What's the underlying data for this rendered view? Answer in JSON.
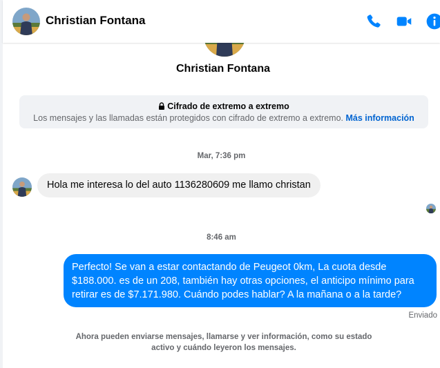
{
  "header": {
    "contact_name": "Christian Fontana",
    "icons": {
      "call": "phone-icon",
      "video": "video-camera-icon",
      "info": "info-icon"
    },
    "accent_color": "#0084ff"
  },
  "profile": {
    "name": "Christian Fontana"
  },
  "encryption_notice": {
    "title": "Cifrado de extremo a extremo",
    "body": "Los mensajes y las llamadas están protegidos con cifrado de extremo a extremo.",
    "link": "Más información"
  },
  "messages": [
    {
      "timestamp": "Mar, 7:36 pm",
      "direction": "incoming",
      "text": "Hola me interesa lo del auto 1136280609 me llamo christan"
    },
    {
      "timestamp": "8:46 am",
      "direction": "outgoing",
      "text": "Perfecto!  Se van a estar contactando de Peugeot 0km, La cuota desde $188.000. es de un 208, también hay otras opciones, el anticipo mínimo para retirar es de $7.171.980. Cuándo podes hablar? A la mañana o a la tarde?",
      "status": "Enviado"
    }
  ],
  "footer_note": "Ahora pueden enviarse mensajes, llamarse y ver información, como su estado activo y cuándo leyeron los mensajes."
}
